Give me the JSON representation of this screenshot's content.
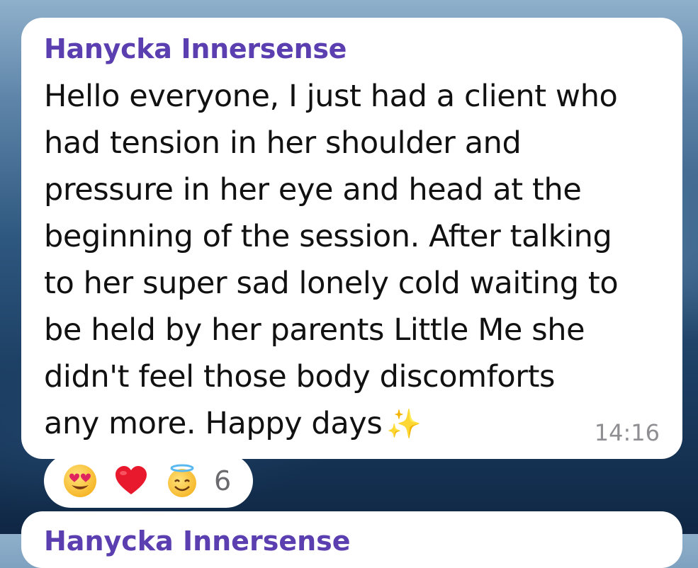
{
  "message": {
    "sender": "Hanycka Innersense",
    "lines": [
      "Hello everyone, I just had a client who",
      "had tension in her shoulder and",
      "pressure in her eye and head at the",
      "beginning of the session. After talking",
      "to her super sad lonely cold waiting to",
      "be held by her parents Little Me she",
      "didn't feel those body discomforts",
      "any more. Happy days"
    ],
    "emoji": "✨",
    "time": "14:16"
  },
  "reactions": {
    "items": [
      {
        "icon": "heart-eyes-emoji-icon"
      },
      {
        "icon": "red-heart-emoji-icon"
      },
      {
        "icon": "halo-smile-emoji-icon"
      }
    ],
    "count": "6"
  },
  "next_message": {
    "sender_partial": "Hanycka Innersense"
  },
  "colors": {
    "sender": "#5b3fb0",
    "bubble": "#ffffff",
    "time": "#8e8e93"
  }
}
